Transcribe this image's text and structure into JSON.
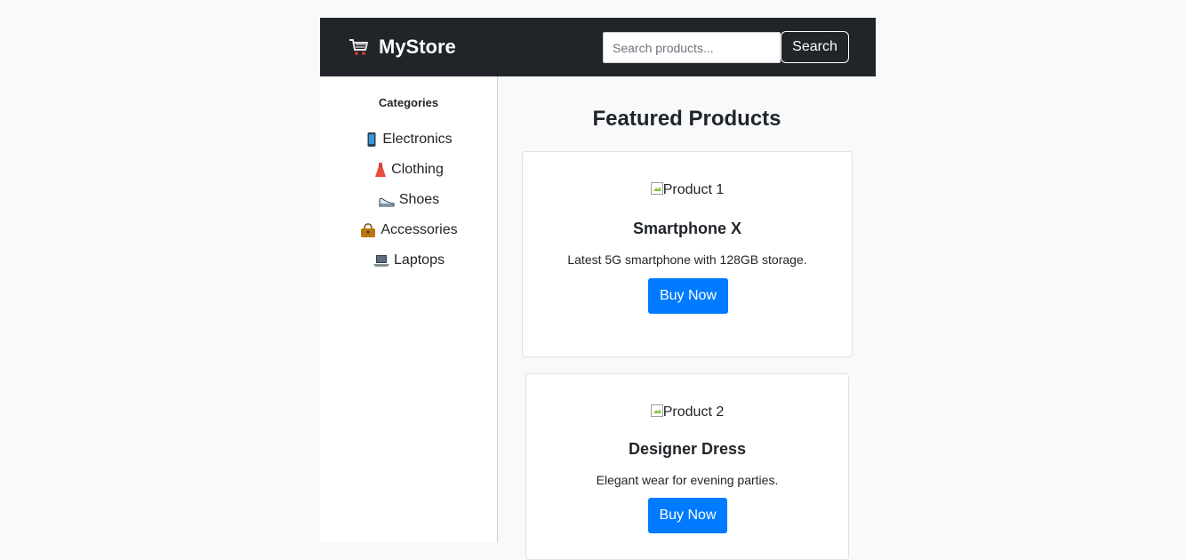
{
  "header": {
    "brand": "MyStore",
    "brand_icon": "shopping-cart-icon",
    "search_placeholder": "Search products...",
    "search_value": "",
    "search_button": "Search"
  },
  "sidebar": {
    "title": "Categories",
    "items": [
      {
        "label": "Electronics",
        "icon": "mobile-phone-icon"
      },
      {
        "label": "Clothing",
        "icon": "dress-icon"
      },
      {
        "label": "Shoes",
        "icon": "shoe-icon"
      },
      {
        "label": "Accessories",
        "icon": "handbag-icon"
      },
      {
        "label": "Laptops",
        "icon": "laptop-icon"
      }
    ]
  },
  "main": {
    "title": "Featured Products",
    "products": [
      {
        "image_alt": "Product 1",
        "name": "Smartphone X",
        "description": "Latest 5G smartphone with 128GB storage.",
        "button": "Buy Now"
      },
      {
        "image_alt": "Product 2",
        "name": "Designer Dress",
        "description": "Elegant wear for evening parties.",
        "button": "Buy Now"
      }
    ]
  },
  "colors": {
    "navbar_bg": "#212529",
    "page_bg": "#f8f9fa",
    "primary": "#007bff",
    "text": "#212529"
  }
}
